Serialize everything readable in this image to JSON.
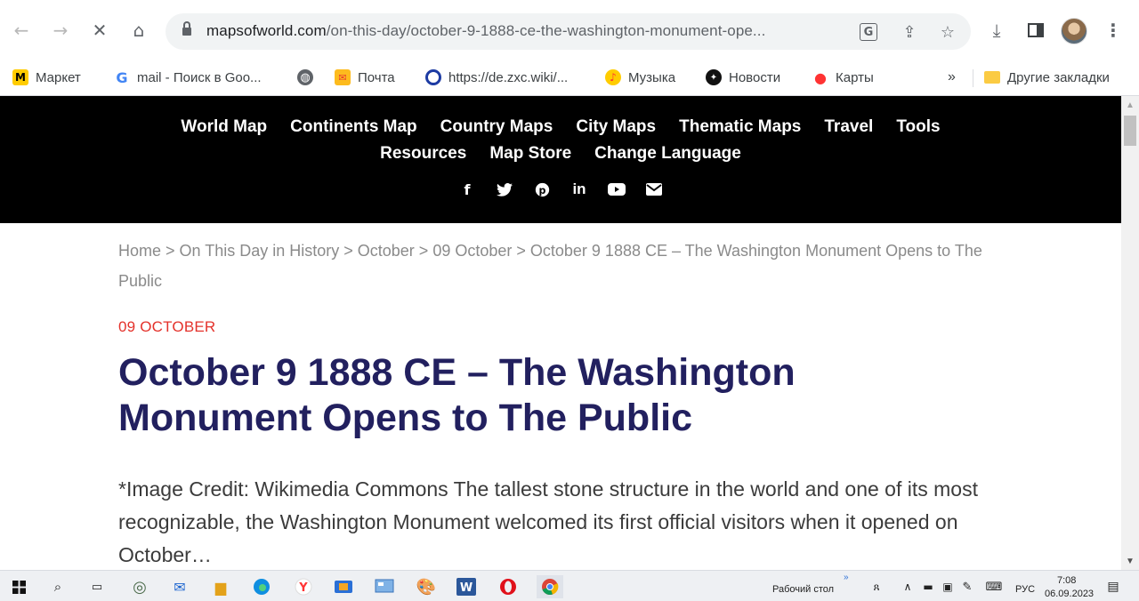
{
  "browser": {
    "url_domain": "mapsofworld.com",
    "url_path": "/on-this-day/october-9-1888-ce-the-washington-monument-ope..."
  },
  "bookmarks": [
    {
      "label": "Маркет",
      "icon": "yandex-market-icon"
    },
    {
      "label": "mail - Поиск в Goo...",
      "icon": "google-icon"
    },
    {
      "label": "",
      "icon": "globe-icon"
    },
    {
      "label": "Почта",
      "icon": "mail-icon"
    },
    {
      "label": "https://de.zxc.wiki/...",
      "icon": "zxc-wiki-icon"
    },
    {
      "label": "Музыка",
      "icon": "music-icon"
    },
    {
      "label": "Новости",
      "icon": "news-icon"
    },
    {
      "label": "Карты",
      "icon": "maps-pin-icon"
    }
  ],
  "bookmarks_overflow": "»",
  "other_bookmarks": "Другие закладки",
  "site_menu": {
    "row1": [
      "World Map",
      "Continents Map",
      "Country Maps",
      "City Maps",
      "Thematic Maps",
      "Travel",
      "Tools"
    ],
    "row2": [
      "Resources",
      "Map Store",
      "Change Language"
    ]
  },
  "breadcrumb": {
    "home": "Home",
    "sep": " > ",
    "on_this_day": "On This Day in History",
    "month": "October",
    "day": "09 October",
    "current": "October 9 1888 CE – The Washington Monument Opens to The Public"
  },
  "article": {
    "category": "09 OCTOBER",
    "title": "October 9 1888 CE – The Washington Monument Opens to The Public",
    "excerpt": "*Image Credit: Wikimedia Commons The tallest stone structure in the world and one of its most recognizable, the Washington Monument welcomed its first official visitors when it opened on October…"
  },
  "taskbar": {
    "desktop_label": "Рабочий стол",
    "chevron": "»",
    "language": "РУС",
    "time": "7:08",
    "date": "06.09.2023"
  },
  "colors": {
    "nav_bg": "#000000",
    "title": "#22205f",
    "category": "#e4322b",
    "breadcrumb": "#8a8a8a"
  }
}
